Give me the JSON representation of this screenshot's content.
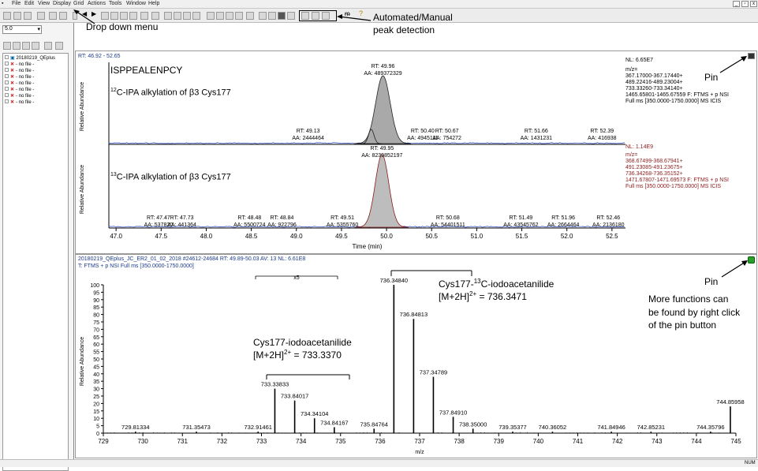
{
  "menu": [
    "File",
    "Edit",
    "View",
    "Display",
    "Grid",
    "Actions",
    "Tools",
    "Window",
    "Help"
  ],
  "zoom_value": "5.0",
  "tree": [
    "20180219_QEplus",
    "- no file -",
    "- no file -",
    "- no file -",
    "- no file -",
    "- no file -",
    "- no file -",
    "- no file -"
  ],
  "annotations": {
    "dropdown": "Drop down  menu",
    "peak1": "Automated/Manual",
    "peak2": "peak detection",
    "pin1": "Pin",
    "pin2": "Pin",
    "more1": "More functions can",
    "more2": "be found  by right click",
    "more3": "of the pin button"
  },
  "chrom": {
    "rt_range": "RT: 46.92 - 52.65",
    "peptide": "ISPPEALENPCY",
    "label12": "C-IPA alkylation of β3 Cys177",
    "label13": "C-IPA alkylation of β3 Cys177",
    "sup12": "12",
    "sup13": "13",
    "ylabel": "Relative Abundance",
    "xlabel": "Time (min)",
    "nl1": "NL: 6.65E7",
    "info1": [
      "m/z=",
      "367.17000-367.17440+",
      "489.22416-489.23004+",
      "733.33260-733.34140+",
      "1465.65801-1465.67559 F: FTMS + p NSI",
      "Full ms [350.0000-1750.0000]  MS  ICIS"
    ],
    "nl2": "NL: 1.14E9",
    "info2": [
      "m/z=",
      "368.67499-368.67941+",
      "491.23085-491.23675+",
      "736.34268-736.35152+",
      "1471.67807-1471.69573 F: FTMS + p NSI",
      "Full ms [350.0000-1750.0000]  MS  ICIS"
    ],
    "xticks": [
      "47.0",
      "47.5",
      "48.0",
      "48.5",
      "49.0",
      "49.5",
      "50.0",
      "50.5",
      "51.0",
      "51.5",
      "52.0",
      "52.5"
    ],
    "top_peaks": [
      [
        "RT: 49.96",
        "AA: 489372329"
      ],
      [
        "RT: 49.13",
        "AA: 2444464"
      ],
      [
        "RT: 50.40",
        "AA: 4945111"
      ],
      [
        "RT: 50.67",
        "AA: 754272"
      ],
      [
        "RT: 51.66",
        "AA: 1431231"
      ],
      [
        "RT: 52.39",
        "AA: 416938"
      ]
    ],
    "bot_peaks": [
      [
        "RT: 49.95",
        "AA: 8239852197"
      ],
      [
        "RT: 47.47",
        "AA: 537820"
      ],
      [
        "RT: 47.73",
        "AA: 441364"
      ],
      [
        "RT: 48.48",
        "AA: 5500724"
      ],
      [
        "RT: 48.84",
        "AA: 922796"
      ],
      [
        "RT: 49.51",
        "AA: 5355760"
      ],
      [
        "RT: 50.68",
        "AA: 54401511"
      ],
      [
        "RT: 51.49",
        "AA: 43545762"
      ],
      [
        "RT: 51.96",
        "AA: 2664464"
      ],
      [
        "RT: 52.46",
        "AA: 2136180"
      ]
    ]
  },
  "spec": {
    "header1": "20180219_QEplus_JC_ER2_01_02_2018 #24612-24684  RT: 49.89-50.03  AV: 13  NL: 6.61E8",
    "header2": "T: FTMS + p NSI Full ms [350.0000-1750.0000]",
    "ylabel": "Relative Abundance",
    "xlabel": "m/z",
    "x5": "x5",
    "cys12_name": "Cys177-iodoacetanilide",
    "cys12_ion": "[M+2H]",
    "cys12_charge": "2+",
    "cys12_val": "= 733.3370",
    "cys13_pre": "Cys177-",
    "cys13_sup": "13",
    "cys13_post": "C-iodoacetanilide",
    "cys13_ion": "[M+2H]",
    "cys13_charge": "2+",
    "cys13_val": "= 736.3471",
    "yticks": [
      "0",
      "5",
      "10",
      "15",
      "20",
      "25",
      "30",
      "35",
      "40",
      "45",
      "50",
      "55",
      "60",
      "65",
      "70",
      "75",
      "80",
      "85",
      "90",
      "95",
      "100"
    ],
    "xticks": [
      "729",
      "730",
      "731",
      "732",
      "733",
      "734",
      "735",
      "736",
      "737",
      "738",
      "739",
      "740",
      "741",
      "742",
      "743",
      "744",
      "745"
    ]
  },
  "chart_data": [
    {
      "type": "line",
      "title": "",
      "xlabel": "Time (min)",
      "ylabel": "Relative Abundance",
      "xlim": [
        46.92,
        52.65
      ],
      "series": [
        {
          "name": "",
          "x": [
            49.13,
            49.96,
            50.4,
            50.67,
            51.66,
            52.39
          ],
          "y": [
            2,
            100,
            2,
            1,
            1,
            1
          ]
        }
      ]
    },
    {
      "type": "line",
      "title": "",
      "xlabel": "Time (min)",
      "ylabel": "Relative Abundance",
      "xlim": [
        46.92,
        52.65
      ],
      "series": [
        {
          "name": "",
          "x": [
            47.47,
            47.73,
            48.48,
            48.84,
            49.51,
            49.95,
            50.68,
            51.49,
            51.96,
            52.46
          ],
          "y": [
            0,
            0,
            0,
            0,
            0,
            100,
            1,
            1,
            0,
            0
          ]
        }
      ]
    },
    {
      "type": "bar",
      "title": "",
      "xlabel": "m/z",
      "ylabel": "Relative Abundance",
      "xlim": [
        729,
        745
      ],
      "ylim": [
        0,
        100
      ],
      "peaks": [
        {
          "mz": 729.81334,
          "y": 1
        },
        {
          "mz": 731.35473,
          "y": 1
        },
        {
          "mz": 732.91461,
          "y": 1
        },
        {
          "mz": 733.33833,
          "y": 30
        },
        {
          "mz": 733.84017,
          "y": 22
        },
        {
          "mz": 734.34104,
          "y": 10
        },
        {
          "mz": 734.84167,
          "y": 4
        },
        {
          "mz": 735.84764,
          "y": 3
        },
        {
          "mz": 736.3484,
          "y": 100
        },
        {
          "mz": 736.84813,
          "y": 77
        },
        {
          "mz": 737.34789,
          "y": 38
        },
        {
          "mz": 737.8491,
          "y": 11
        },
        {
          "mz": 738.35,
          "y": 3
        },
        {
          "mz": 739.35377,
          "y": 1
        },
        {
          "mz": 740.36052,
          "y": 1
        },
        {
          "mz": 741.84946,
          "y": 1
        },
        {
          "mz": 742.85231,
          "y": 1
        },
        {
          "mz": 744.35796,
          "y": 1
        },
        {
          "mz": 744.85958,
          "y": 18
        }
      ]
    }
  ]
}
